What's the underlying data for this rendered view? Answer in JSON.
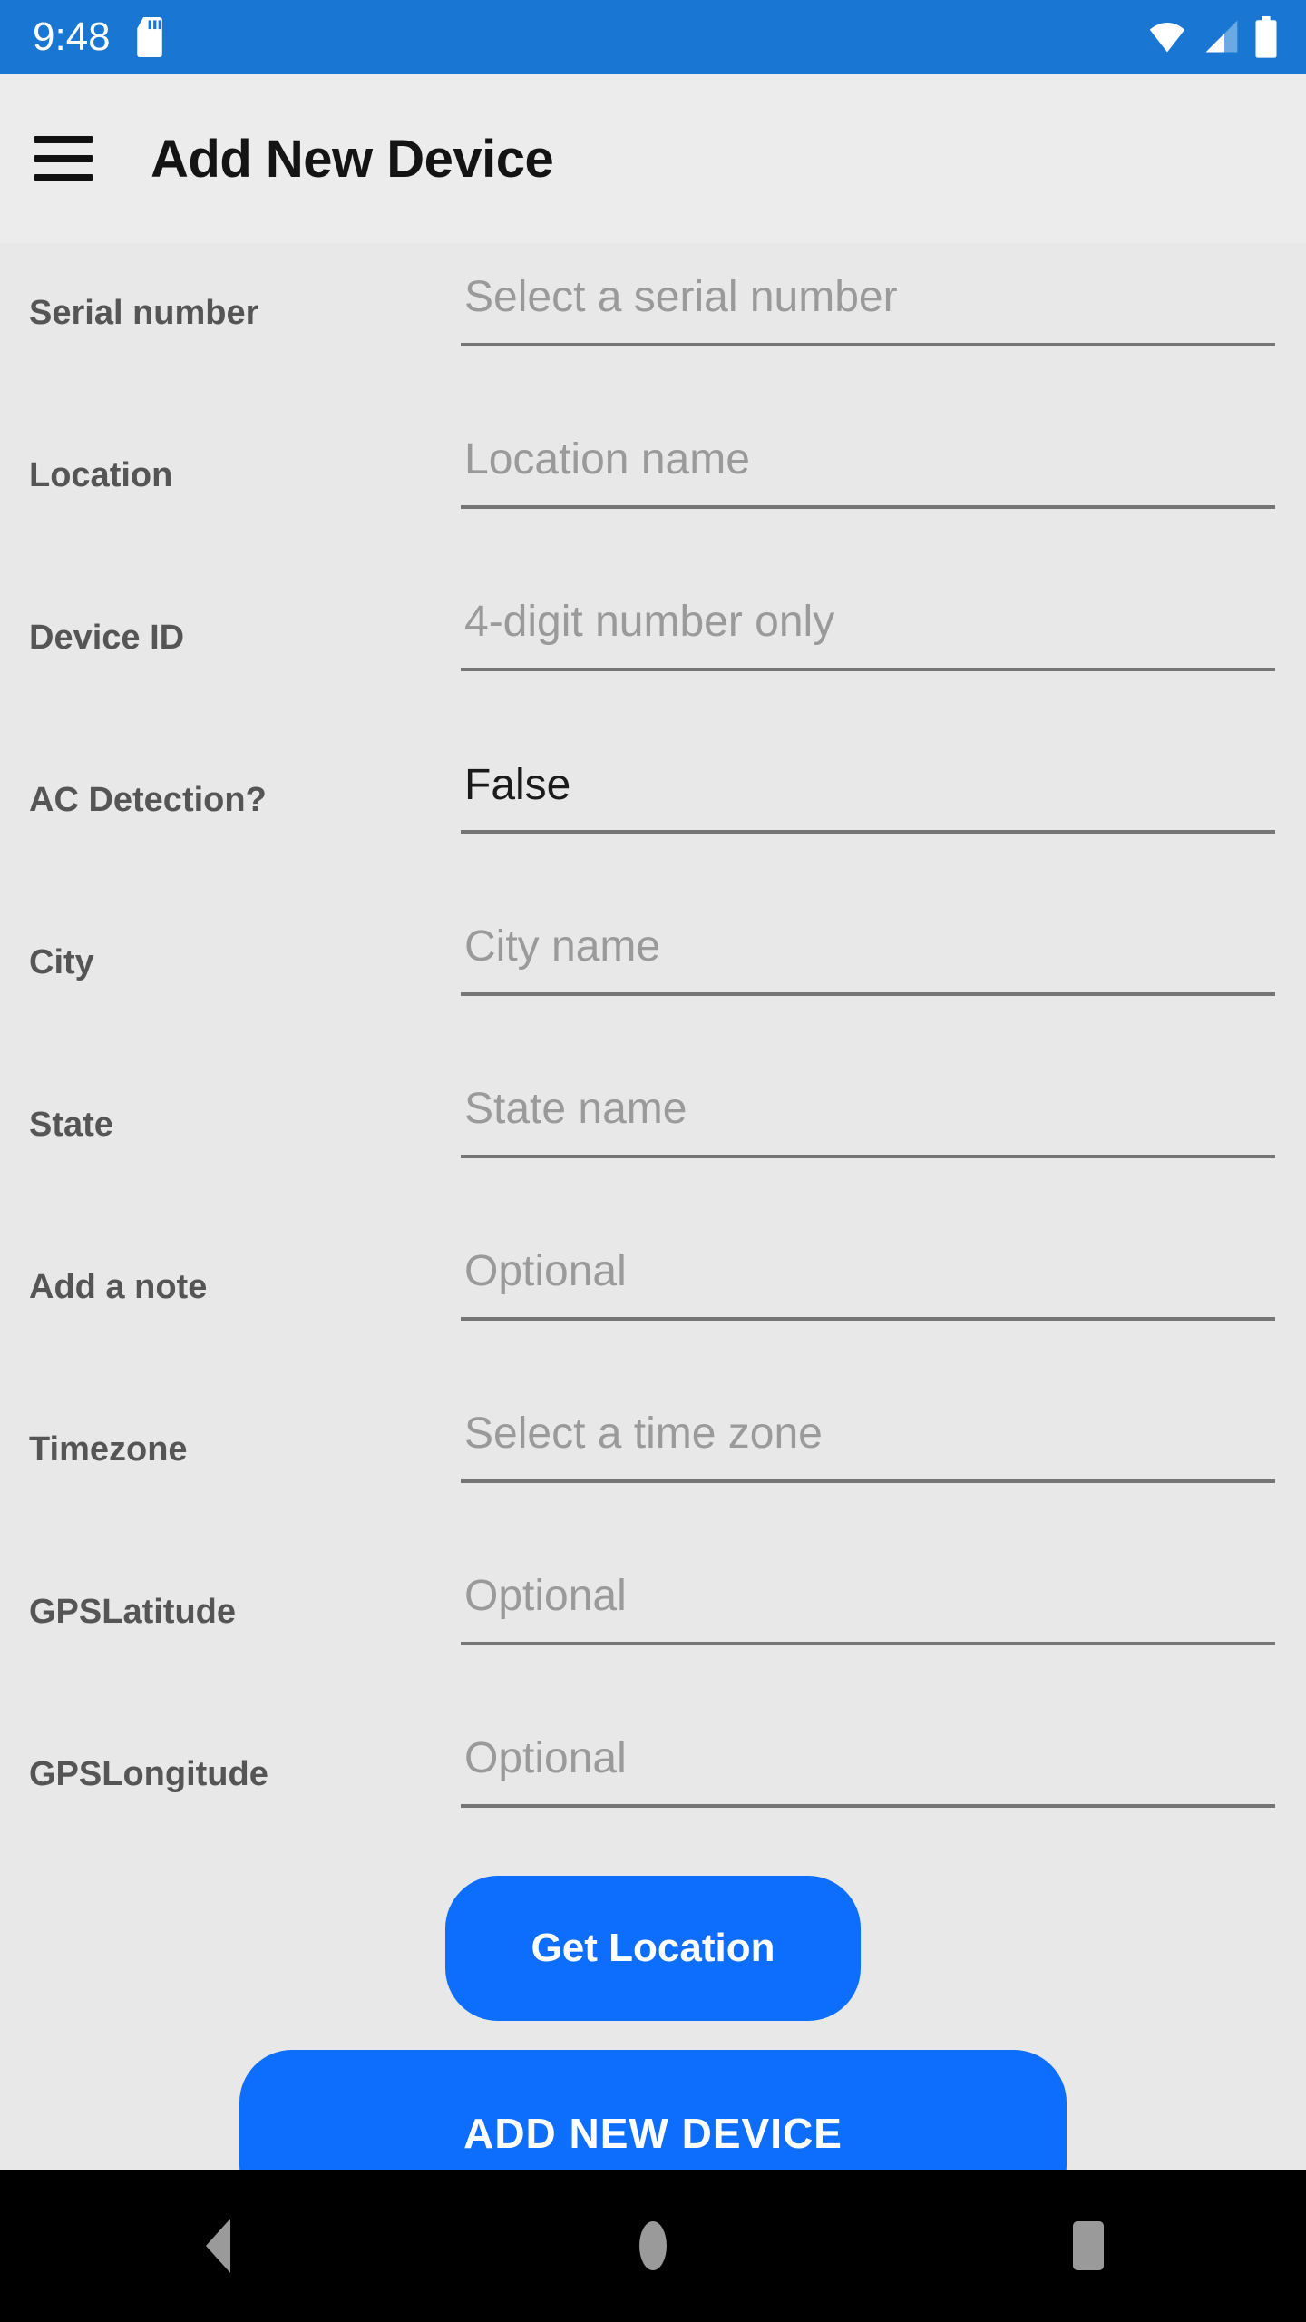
{
  "status_bar": {
    "time": "9:48",
    "background_color": "#1976d2",
    "icons": [
      "sd-card-icon",
      "wifi-icon",
      "cellular-signal-icon",
      "battery-icon"
    ]
  },
  "app_bar": {
    "menu_icon": "hamburger-menu-icon",
    "title": "Add New Device",
    "background_color": "#ececec"
  },
  "form": {
    "fields": [
      {
        "label": "Serial number",
        "placeholder": "Select a serial number",
        "value": "",
        "type": "select"
      },
      {
        "label": "Location",
        "placeholder": "Location name",
        "value": "",
        "type": "text"
      },
      {
        "label": "Device ID",
        "placeholder": "4-digit number only",
        "value": "",
        "type": "text"
      },
      {
        "label": "AC Detection?",
        "placeholder": "",
        "value": "False",
        "type": "select"
      },
      {
        "label": "City",
        "placeholder": "City name",
        "value": "",
        "type": "text"
      },
      {
        "label": "State",
        "placeholder": "State name",
        "value": "",
        "type": "text"
      },
      {
        "label": "Add a note",
        "placeholder": "Optional",
        "value": "",
        "type": "text"
      },
      {
        "label": "Timezone",
        "placeholder": "Select a time zone",
        "value": "",
        "type": "select"
      },
      {
        "label": "GPSLatitude",
        "placeholder": "Optional",
        "value": "",
        "type": "text"
      },
      {
        "label": "GPSLongitude",
        "placeholder": "Optional",
        "value": "",
        "type": "text"
      }
    ]
  },
  "buttons": {
    "get_location": "Get Location",
    "add_new_device": "ADD NEW DEVICE",
    "accent_color": "#0d6efd"
  },
  "nav_bar": {
    "back": "back-icon",
    "home": "home-icon",
    "recents": "recents-icon",
    "background_color": "#000000"
  }
}
